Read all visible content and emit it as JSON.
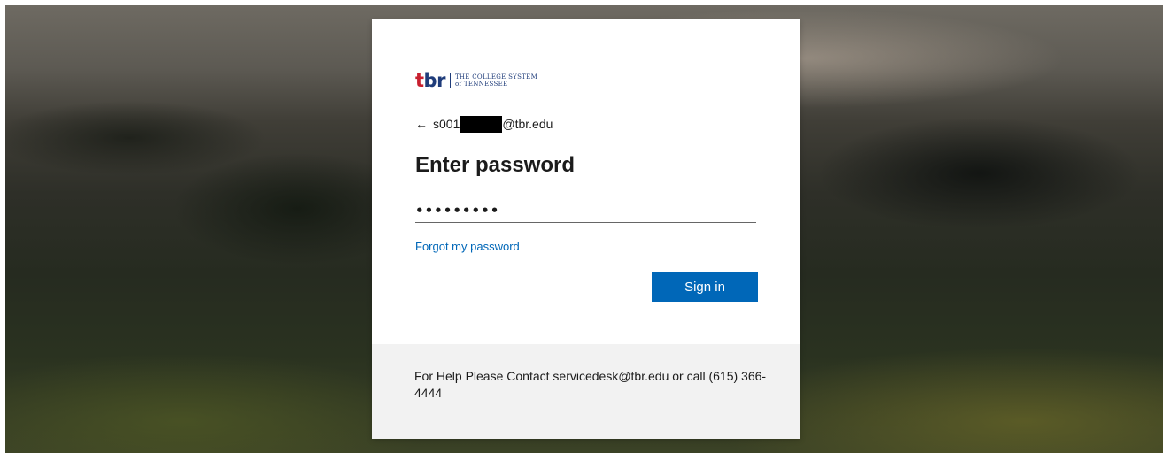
{
  "brand": {
    "logo_t": "t",
    "logo_br": "br",
    "logo_line1": "THE COLLEGE SYSTEM",
    "logo_line2": "of TENNESSEE",
    "colors": {
      "red": "#c8202f",
      "navy": "#1f3c7a"
    }
  },
  "identity": {
    "back_icon": "←",
    "email_prefix": "s001",
    "email_suffix": "@tbr.edu"
  },
  "form": {
    "title": "Enter password",
    "password_value": "•••••••••",
    "forgot_label": "Forgot my password",
    "signin_label": "Sign in",
    "accent_color": "#0067b8"
  },
  "footer": {
    "help_text": "For Help Please Contact servicedesk@tbr.edu or call (615) 366-4444"
  }
}
